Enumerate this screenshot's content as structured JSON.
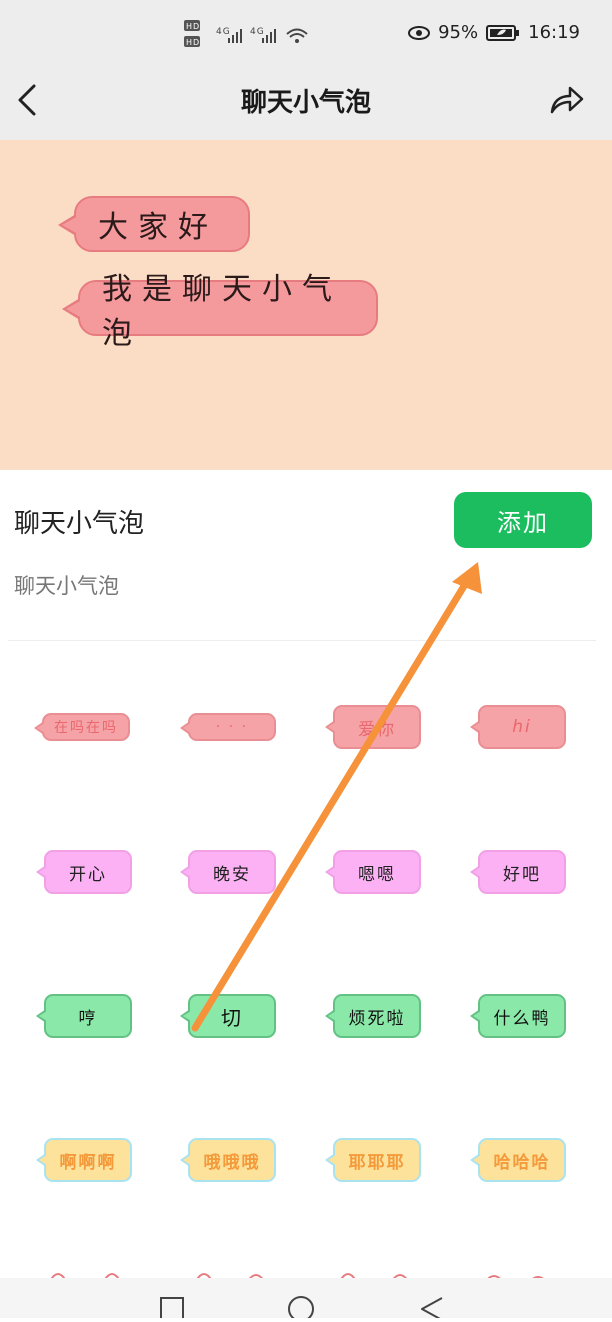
{
  "status": {
    "network": "HD 46 46",
    "battery": "95%",
    "time": "16:19"
  },
  "header": {
    "title": "聊天小气泡"
  },
  "preview": {
    "bubbles": [
      "大家好",
      "我是聊天小气泡"
    ]
  },
  "pack": {
    "name": "聊天小气泡",
    "description": "聊天小气泡",
    "add_label": "添加"
  },
  "stickers": [
    {
      "text": "在吗在吗",
      "style": "pink",
      "color": "#f5a3a6"
    },
    {
      "text": "· · ·",
      "style": "pink",
      "color": "#f5a3a6"
    },
    {
      "text": "爱你",
      "style": "pink",
      "color": "#f5a3a6"
    },
    {
      "text": "hi",
      "style": "pink",
      "color": "#f5a3a6"
    },
    {
      "text": "开心",
      "style": "magenta",
      "color": "#fcb1f4"
    },
    {
      "text": "晚安",
      "style": "magenta",
      "color": "#fcb1f4"
    },
    {
      "text": "嗯嗯",
      "style": "magenta",
      "color": "#fcb1f4"
    },
    {
      "text": "好吧",
      "style": "magenta",
      "color": "#fcb1f4"
    },
    {
      "text": "哼",
      "style": "green",
      "color": "#8ae8a9"
    },
    {
      "text": "切",
      "style": "green",
      "color": "#8ae8a9"
    },
    {
      "text": "烦死啦",
      "style": "green",
      "color": "#8ae8a9"
    },
    {
      "text": "什么鸭",
      "style": "green",
      "color": "#8ae8a9"
    },
    {
      "text": "啊啊啊",
      "style": "yellow",
      "color": "#fde29c"
    },
    {
      "text": "哦哦哦",
      "style": "yellow",
      "color": "#fde29c"
    },
    {
      "text": "耶耶耶",
      "style": "yellow",
      "color": "#fde29c"
    },
    {
      "text": "哈哈哈",
      "style": "yellow",
      "color": "#fde29c"
    }
  ],
  "colors": {
    "accent": "#1bbd5f",
    "preview_bg": "#fbdcc5",
    "annotation_arrow": "#f5923a"
  },
  "icons": {
    "back": "chevron-left-icon",
    "share": "share-icon",
    "nav": [
      "square-icon",
      "circle-icon",
      "triangle-back-icon"
    ]
  }
}
